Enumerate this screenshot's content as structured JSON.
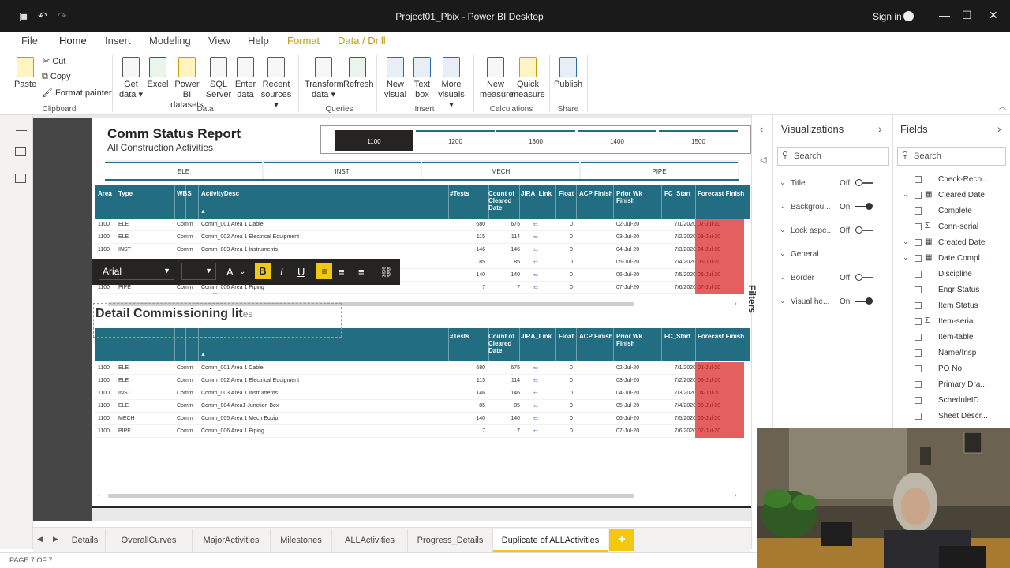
{
  "window": {
    "title": "Project01_Pbix - Power BI Desktop",
    "sign_in": "Sign in"
  },
  "menu": {
    "tabs": [
      "File",
      "Home",
      "Insert",
      "Modeling",
      "View",
      "Help",
      "Format",
      "Data / Drill"
    ]
  },
  "ribbon": {
    "clipboard": {
      "paste": "Paste",
      "cut": "Cut",
      "copy": "Copy",
      "format_painter": "Format painter",
      "group": "Clipboard"
    },
    "data": {
      "get_data": [
        "Get",
        "data ▾"
      ],
      "excel": "Excel",
      "pbi_datasets": [
        "Power BI",
        "datasets"
      ],
      "sql": [
        "SQL",
        "Server"
      ],
      "enter": [
        "Enter",
        "data"
      ],
      "recent": [
        "Recent",
        "sources ▾"
      ],
      "group": "Data"
    },
    "queries": {
      "transform": [
        "Transform",
        "data ▾"
      ],
      "refresh": "Refresh",
      "group": "Queries"
    },
    "insert": {
      "new_visual": [
        "New",
        "visual"
      ],
      "text_box": [
        "Text",
        "box"
      ],
      "more_visuals": [
        "More",
        "visuals ▾"
      ],
      "group": "Insert"
    },
    "calculations": {
      "new_measure": [
        "New",
        "measure"
      ],
      "quick_measure": [
        "Quick",
        "measure"
      ],
      "group": "Calculations"
    },
    "share": {
      "publish": "Publish",
      "group": "Share"
    }
  },
  "report": {
    "title": "Comm Status Report",
    "subtitle": "All Construction Activities",
    "area_slicer": [
      "1100",
      "1200",
      "1300",
      "1400",
      "1500"
    ],
    "area_selected": "1100",
    "type_slicer": [
      "ELE",
      "INST",
      "MECH",
      "PIPE"
    ]
  },
  "table1": {
    "headers": [
      "Area",
      "Type",
      "WBS",
      "ActivityDesc",
      "#Tests",
      "Count of Cleared Date",
      "JIRA_Link",
      "Float",
      "ACP Finish",
      "Prior Wk Finish",
      "FC_Start",
      "Forecast Finish"
    ],
    "rows": [
      [
        "1100",
        "ELE",
        "Comm",
        "Comm_001 Area 1 Cable",
        "680",
        "675",
        "⇆",
        "0",
        "",
        "02-Jul-20",
        "7/1/2020",
        "02-Jul-20"
      ],
      [
        "1100",
        "ELE",
        "Comm",
        "Comm_002 Area 1 Electrical Equipment",
        "115",
        "114",
        "⇆",
        "0",
        "",
        "03-Jul-20",
        "7/2/2020",
        "03-Jul-20"
      ],
      [
        "1100",
        "INST",
        "Comm",
        "Comm_003 Area 1 Instruments",
        "146",
        "146",
        "⇆",
        "0",
        "",
        "04-Jul-20",
        "7/3/2020",
        "04-Jul-20"
      ],
      [
        "",
        "",
        "",
        "",
        "85",
        "85",
        "⇆",
        "0",
        "",
        "05-Jul-20",
        "7/4/2020",
        "05-Jul-20"
      ],
      [
        "",
        "",
        "",
        "",
        "140",
        "140",
        "⇆",
        "0",
        "",
        "06-Jul-20",
        "7/5/2020",
        "06-Jul-20"
      ],
      [
        "1100",
        "PIPE",
        "Comm",
        "Comm_006 Area 1 Piping",
        "7",
        "7",
        "⇆",
        "0",
        "",
        "07-Jul-20",
        "7/6/2020",
        "07-Jul-20"
      ]
    ]
  },
  "table2": {
    "headers": [
      "",
      "",
      "",
      "",
      "#Tests",
      "Count of Cleared Date",
      "JIRA_Link",
      "Float",
      "ACP Finish",
      "Prior Wk Finish",
      "FC_Start",
      "Forecast Finish"
    ],
    "rows": [
      [
        "1100",
        "ELE",
        "Comm",
        "Comm_001 Area 1 Cable",
        "680",
        "675",
        "⇆",
        "0",
        "",
        "02-Jul-20",
        "7/1/2020",
        "02-Jul-20"
      ],
      [
        "1100",
        "ELE",
        "Comm",
        "Comm_002 Area 1 Electrical Equipment",
        "115",
        "114",
        "⇆",
        "0",
        "",
        "03-Jul-20",
        "7/2/2020",
        "03-Jul-20"
      ],
      [
        "1100",
        "INST",
        "Comm",
        "Comm_003 Area 1 Instruments",
        "146",
        "146",
        "⇆",
        "0",
        "",
        "04-Jul-20",
        "7/3/2020",
        "04-Jul-20"
      ],
      [
        "1100",
        "ELE",
        "Comm",
        "Comm_004 Area1 Junction Box",
        "85",
        "85",
        "⇆",
        "0",
        "",
        "05-Jul-20",
        "7/4/2020",
        "05-Jul-20"
      ],
      [
        "1100",
        "MECH",
        "Comm",
        "Comm_005 Area 1 Mech Equip",
        "140",
        "140",
        "⇆",
        "0",
        "",
        "06-Jul-20",
        "7/5/2020",
        "06-Jul-20"
      ],
      [
        "1100",
        "PIPE",
        "Comm",
        "Comm_006 Area 1 Piping",
        "7",
        "7",
        "⇆",
        "0",
        "",
        "07-Jul-20",
        "7/6/2020",
        "07-Jul-20"
      ]
    ]
  },
  "format_toolbar": {
    "font": "Arial",
    "size": "",
    "font_color": "A",
    "bold": "B",
    "italic": "I",
    "underline": "U"
  },
  "textbox": {
    "typed": "Detail Commissioning lit",
    "placeholder": "es"
  },
  "filters_label": "Filters",
  "visualizations": {
    "title": "Visualizations",
    "search": "Search",
    "rows": [
      {
        "label": "Title",
        "state": "Off"
      },
      {
        "label": "Backgrou...",
        "state": "On"
      },
      {
        "label": "Lock aspe...",
        "state": "Off"
      },
      {
        "label": "General",
        "state": ""
      },
      {
        "label": "Border",
        "state": "Off"
      },
      {
        "label": "Visual he...",
        "state": "On"
      }
    ]
  },
  "fields": {
    "title": "Fields",
    "search": "Search",
    "items": [
      {
        "label": "Check-Reco...",
        "sigma": false,
        "expand": false,
        "table": false
      },
      {
        "label": "Cleared Date",
        "sigma": false,
        "expand": true,
        "table": true
      },
      {
        "label": "Complete",
        "sigma": false,
        "expand": false,
        "table": false
      },
      {
        "label": "Conn-serial",
        "sigma": true,
        "expand": false,
        "table": false
      },
      {
        "label": "Created Date",
        "sigma": false,
        "expand": true,
        "table": true
      },
      {
        "label": "Date Compl...",
        "sigma": false,
        "expand": true,
        "table": true
      },
      {
        "label": "Discipline",
        "sigma": false,
        "expand": false,
        "table": false
      },
      {
        "label": "Engr Status",
        "sigma": false,
        "expand": false,
        "table": false
      },
      {
        "label": "Item Status",
        "sigma": false,
        "expand": false,
        "table": false
      },
      {
        "label": "Item-serial",
        "sigma": true,
        "expand": false,
        "table": false
      },
      {
        "label": "Item-table",
        "sigma": false,
        "expand": false,
        "table": false
      },
      {
        "label": "Name/Insp",
        "sigma": false,
        "expand": false,
        "table": false
      },
      {
        "label": "PO No",
        "sigma": false,
        "expand": false,
        "table": false
      },
      {
        "label": "Primary Dra...",
        "sigma": false,
        "expand": false,
        "table": false
      },
      {
        "label": "ScheduleID",
        "sigma": false,
        "expand": false,
        "table": false
      },
      {
        "label": "Sheet Descr...",
        "sigma": false,
        "expand": false,
        "table": false
      }
    ]
  },
  "page_tabs": [
    "Details",
    "OverallCurves",
    "MajorActivities",
    "Milestones",
    "ALLActivities",
    "Progress_Details",
    "Duplicate of ALLActivities"
  ],
  "active_page_tab": "Duplicate of ALLActivities",
  "add_tab": "+",
  "status": "PAGE 7 OF 7",
  "colors": {
    "accent": "#f2c811",
    "header": "#226d82",
    "forecast": "#e46060"
  }
}
